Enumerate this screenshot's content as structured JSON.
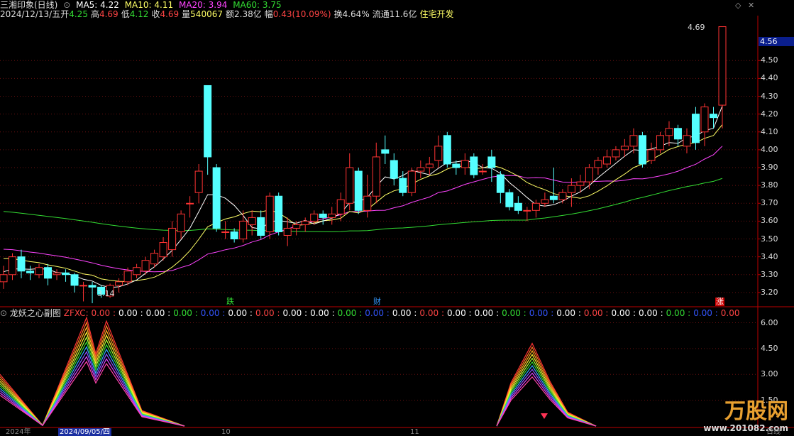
{
  "header": {
    "title": "三湘印象(日线)",
    "ma": [
      {
        "label": "MA5: 4.22",
        "color": "#ffffff"
      },
      {
        "label": "MA10: 4.11",
        "color": "#ffff66"
      },
      {
        "label": "MA20: 3.94",
        "color": "#ff44ff"
      },
      {
        "label": "MA60: 3.75",
        "color": "#33dd33"
      }
    ],
    "date": "2024/12/13/五",
    "open_label": "开",
    "open": "4.25",
    "high_label": "高",
    "high": "4.69",
    "low_label": "低",
    "low": "4.12",
    "close_label": "收",
    "close": "4.69",
    "vol_label": "量",
    "vol": "540067",
    "amt_label": "额",
    "amt": "2.38亿",
    "chg_label": "幅",
    "chg": "0.43(10.09%)",
    "turnover": "换4.64%",
    "float": "流通11.6亿",
    "sector": "住宅开发"
  },
  "price_axis": [
    "4.50",
    "4.40",
    "4.30",
    "4.20",
    "4.10",
    "4.00",
    "3.90",
    "3.80",
    "3.70",
    "3.60",
    "3.50",
    "3.40",
    "3.30",
    "3.20"
  ],
  "current_price": "4.56",
  "annotations": {
    "high": "4.69",
    "low": "3.14",
    "marker_die": "跌",
    "marker_cai": "财",
    "marker_zhang": "涨"
  },
  "sub": {
    "title": "龙妖之心副图",
    "indicator": "ZFXC:",
    "values": [
      "0.00",
      "0.00",
      "0.00",
      "0.00",
      "0.00",
      "0.00",
      "0.00",
      "0.00",
      "0.00",
      "0.00",
      "0.00",
      "0.00",
      "0.00",
      "0.00",
      "0.00",
      "0.00",
      "0.00",
      "0.00",
      "0.00",
      "0.00",
      "0.00",
      "0.00",
      "0.00",
      "0.00"
    ],
    "value_colors": [
      "#ff4444",
      "#ffffff",
      "#ffffff",
      "#33dd33",
      "#3355ff",
      "#ffffff",
      "#ff4444",
      "#ffffff",
      "#ffffff",
      "#33dd33",
      "#3355ff",
      "#ffffff",
      "#ff4444",
      "#ffffff",
      "#ffffff",
      "#33dd33",
      "#3355ff",
      "#ffffff",
      "#ff4444",
      "#ffffff",
      "#ffffff",
      "#33dd33",
      "#3355ff",
      "#ff4444"
    ],
    "axis": [
      "6.00",
      "4.50",
      "3.00",
      "1.50"
    ]
  },
  "bottom": {
    "start": "2024年",
    "date": "2024/09/05/四",
    "m10": "10",
    "m11": "11",
    "right": "日线"
  },
  "watermark": {
    "text": "万股网",
    "url": "www.201082.com"
  },
  "chart_data": {
    "type": "candlestick",
    "ylim": [
      3.12,
      4.72
    ],
    "candles": [
      [
        3.26,
        3.3,
        3.22,
        3.35
      ],
      [
        3.3,
        3.4,
        3.27,
        3.42
      ],
      [
        3.4,
        3.32,
        3.28,
        3.44
      ],
      [
        3.32,
        3.31,
        3.27,
        3.35
      ],
      [
        3.3,
        3.34,
        3.28,
        3.36
      ],
      [
        3.34,
        3.28,
        3.24,
        3.36
      ],
      [
        3.3,
        3.31,
        3.27,
        3.33
      ],
      [
        3.31,
        3.3,
        3.26,
        3.33
      ],
      [
        3.3,
        3.24,
        3.2,
        3.31
      ],
      [
        3.24,
        3.24,
        3.15,
        3.26
      ],
      [
        3.24,
        3.23,
        3.14,
        3.26
      ],
      [
        3.23,
        3.19,
        3.17,
        3.24
      ],
      [
        3.18,
        3.24,
        3.17,
        3.25
      ],
      [
        3.24,
        3.26,
        3.2,
        3.28
      ],
      [
        3.26,
        3.32,
        3.24,
        3.34
      ],
      [
        3.3,
        3.34,
        3.28,
        3.36
      ],
      [
        3.32,
        3.38,
        3.3,
        3.4
      ],
      [
        3.36,
        3.42,
        3.34,
        3.44
      ],
      [
        3.4,
        3.48,
        3.38,
        3.51
      ],
      [
        3.44,
        3.56,
        3.4,
        3.6
      ],
      [
        3.54,
        3.64,
        3.5,
        3.66
      ],
      [
        3.7,
        3.7,
        3.62,
        3.74
      ],
      [
        3.76,
        3.88,
        3.7,
        3.92
      ],
      [
        4.36,
        3.96,
        3.86,
        4.36
      ],
      [
        3.9,
        3.56,
        3.54,
        3.92
      ],
      [
        3.54,
        3.54,
        3.5,
        3.6
      ],
      [
        3.54,
        3.5,
        3.48,
        3.56
      ],
      [
        3.5,
        3.6,
        3.48,
        3.66
      ],
      [
        3.58,
        3.62,
        3.52,
        3.66
      ],
      [
        3.62,
        3.52,
        3.5,
        3.66
      ],
      [
        3.54,
        3.74,
        3.5,
        3.76
      ],
      [
        3.74,
        3.54,
        3.52,
        3.76
      ],
      [
        3.52,
        3.56,
        3.46,
        3.62
      ],
      [
        3.56,
        3.58,
        3.52,
        3.6
      ],
      [
        3.58,
        3.6,
        3.54,
        3.62
      ],
      [
        3.6,
        3.64,
        3.58,
        3.66
      ],
      [
        3.64,
        3.62,
        3.58,
        3.66
      ],
      [
        3.62,
        3.64,
        3.58,
        3.68
      ],
      [
        3.64,
        3.72,
        3.6,
        3.76
      ],
      [
        3.7,
        3.9,
        3.66,
        3.98
      ],
      [
        3.88,
        3.66,
        3.64,
        3.9
      ],
      [
        3.66,
        3.74,
        3.62,
        3.86
      ],
      [
        3.74,
        3.96,
        3.7,
        4.04
      ],
      [
        4.0,
        3.98,
        3.92,
        4.08
      ],
      [
        3.94,
        3.84,
        3.8,
        3.98
      ],
      [
        3.84,
        3.76,
        3.74,
        3.88
      ],
      [
        3.76,
        3.88,
        3.74,
        3.9
      ],
      [
        3.88,
        3.9,
        3.84,
        3.94
      ],
      [
        3.9,
        3.92,
        3.86,
        3.96
      ],
      [
        3.94,
        4.02,
        3.9,
        4.08
      ],
      [
        4.08,
        3.92,
        3.9,
        4.1
      ],
      [
        3.92,
        3.9,
        3.86,
        3.94
      ],
      [
        3.9,
        3.94,
        3.86,
        3.98
      ],
      [
        3.96,
        3.86,
        3.84,
        3.98
      ],
      [
        3.88,
        3.88,
        3.86,
        3.92
      ],
      [
        3.96,
        3.9,
        3.82,
        4.0
      ],
      [
        3.86,
        3.76,
        3.7,
        3.88
      ],
      [
        3.76,
        3.68,
        3.66,
        3.78
      ],
      [
        3.7,
        3.66,
        3.64,
        3.74
      ],
      [
        3.66,
        3.66,
        3.6,
        3.68
      ],
      [
        3.66,
        3.7,
        3.62,
        3.72
      ],
      [
        3.7,
        3.72,
        3.68,
        3.76
      ],
      [
        3.74,
        3.72,
        3.7,
        3.9
      ],
      [
        3.72,
        3.76,
        3.7,
        3.78
      ],
      [
        3.76,
        3.8,
        3.68,
        3.84
      ],
      [
        3.8,
        3.82,
        3.76,
        3.86
      ],
      [
        3.82,
        3.9,
        3.78,
        3.92
      ],
      [
        3.9,
        3.94,
        3.86,
        3.96
      ],
      [
        3.92,
        3.96,
        3.9,
        4.0
      ],
      [
        3.96,
        4.0,
        3.94,
        4.02
      ],
      [
        4.0,
        4.02,
        3.96,
        4.06
      ],
      [
        4.02,
        4.08,
        3.98,
        4.12
      ],
      [
        4.08,
        3.92,
        3.9,
        4.1
      ],
      [
        3.94,
        4.0,
        3.92,
        4.04
      ],
      [
        4.0,
        4.08,
        3.98,
        4.1
      ],
      [
        4.08,
        4.12,
        4.02,
        4.16
      ],
      [
        4.12,
        4.06,
        4.02,
        4.14
      ],
      [
        4.02,
        4.08,
        3.98,
        4.12
      ],
      [
        4.2,
        4.04,
        4.0,
        4.24
      ],
      [
        4.1,
        4.24,
        4.02,
        4.26
      ],
      [
        4.2,
        4.18,
        4.12,
        4.24
      ],
      [
        4.25,
        4.69,
        4.12,
        4.69
      ]
    ]
  }
}
